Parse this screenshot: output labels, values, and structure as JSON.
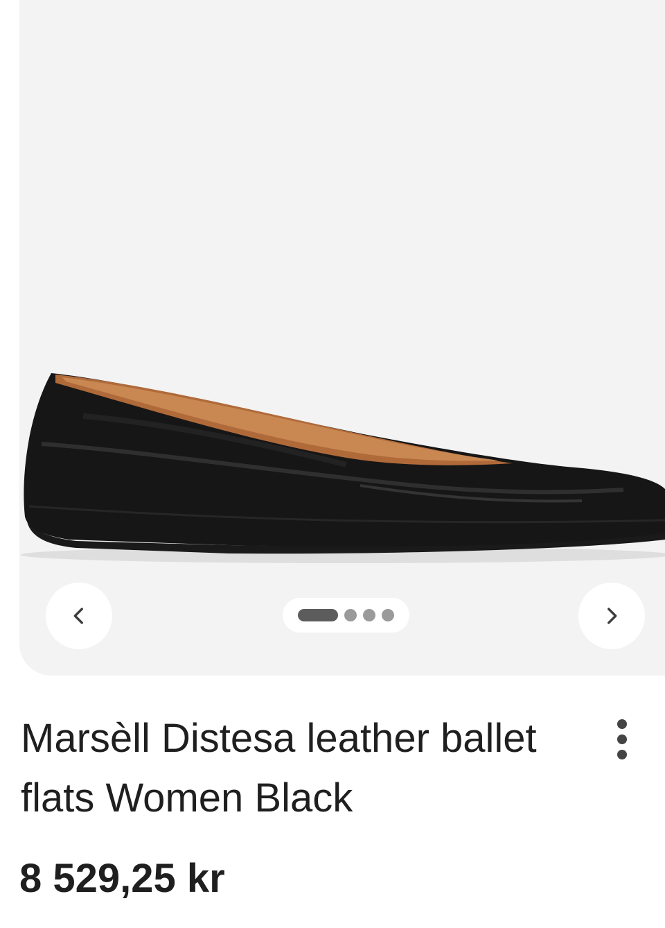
{
  "product": {
    "title": "Marsèll Distesa leather ballet flats Women Black",
    "price": "8 529,25 kr",
    "image_icon": "ballet-flat-shoe-image"
  },
  "carousel": {
    "prev_icon": "chevron-left-icon",
    "next_icon": "chevron-right-icon",
    "image_count": 4,
    "active_index": 0
  },
  "colors": {
    "card_background": "#f3f3f3",
    "text": "#1f1f1f",
    "dot_active": "#5c5c5c",
    "dot_inactive": "#9a9a9a"
  }
}
